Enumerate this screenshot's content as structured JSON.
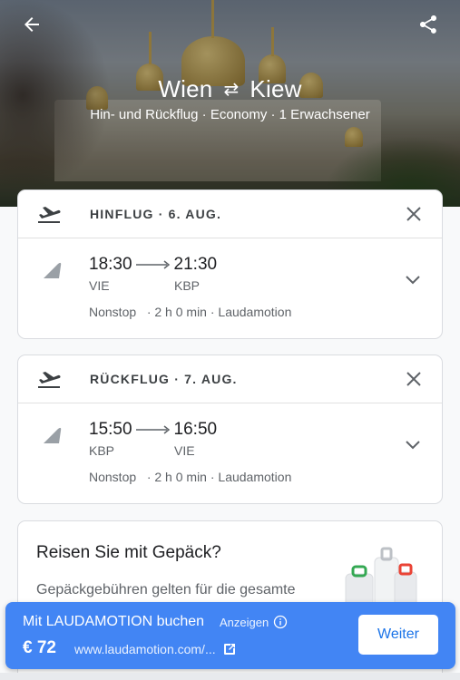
{
  "header": {
    "origin": "Wien",
    "destination": "Kiew",
    "subtitle": "Hin- und Rückflug · Economy · 1 Erwachsener",
    "back_icon": "arrow-back-icon",
    "share_icon": "share-icon"
  },
  "outbound": {
    "title": "HINFLUG · 6. AUG.",
    "depart_time": "18:30",
    "arrive_time": "21:30",
    "depart_code": "VIE",
    "arrive_code": "KBP",
    "stops": "Nonstop",
    "duration": "· 2 h 0 min",
    "airline": "· Laudamotion"
  },
  "return": {
    "title": "RÜCKFLUG · 7. AUG.",
    "depart_time": "15:50",
    "arrive_time": "16:50",
    "depart_code": "KBP",
    "arrive_code": "VIE",
    "stops": "Nonstop",
    "duration": "· 2 h 0 min",
    "airline": "· Laudamotion"
  },
  "baggage": {
    "title": "Reisen Sie mit Gepäck?",
    "text": "Gepäckgebühren gelten für die gesamte"
  },
  "booking": {
    "title": "Mit LAUDAMOTION buchen",
    "ads_label": "Anzeigen",
    "price": "€ 72",
    "url": "www.laudamotion.com/...",
    "button": "Weiter"
  },
  "colors": {
    "accent": "#4285f4",
    "link": "#1a73e8",
    "muted": "#5f6368"
  }
}
